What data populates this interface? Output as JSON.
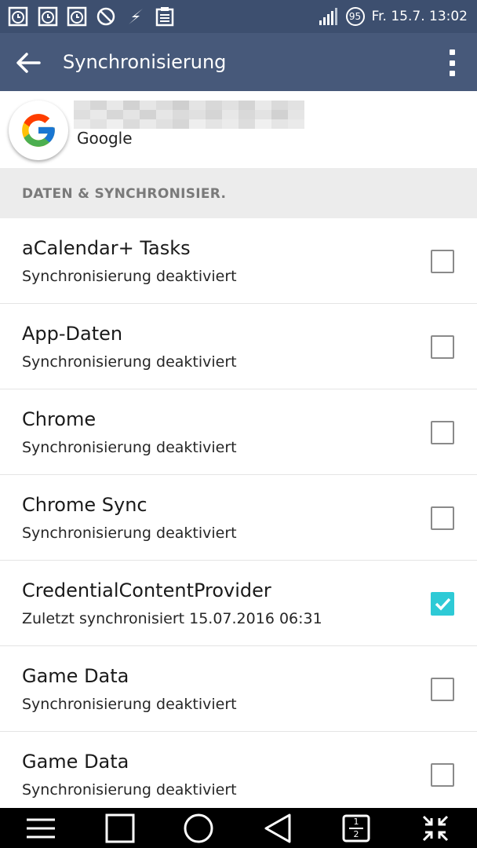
{
  "status_bar": {
    "battery_level": "95",
    "date_time": "Fr. 15.7. 13:02",
    "icons": [
      "alarm-clock-icon",
      "alarm-clock-icon",
      "alarm-clock-icon",
      "do-not-disturb-icon",
      "lightning-icon",
      "clipboard-icon",
      "signal-icon",
      "battery-icon"
    ]
  },
  "app_bar": {
    "title": "Synchronisierung",
    "back_icon": "arrow-left-icon",
    "menu_icon": "overflow-menu-icon"
  },
  "account": {
    "type": "Google",
    "logo": "google-g-icon"
  },
  "section": {
    "title": "DATEN & SYNCHRONISIER."
  },
  "sync_items": [
    {
      "title": "aCalendar+ Tasks",
      "subtitle": "Synchronisierung deaktiviert",
      "checked": false
    },
    {
      "title": "App-Daten",
      "subtitle": "Synchronisierung deaktiviert",
      "checked": false
    },
    {
      "title": "Chrome",
      "subtitle": "Synchronisierung deaktiviert",
      "checked": false
    },
    {
      "title": "Chrome Sync",
      "subtitle": "Synchronisierung deaktiviert",
      "checked": false
    },
    {
      "title": "CredentialContentProvider",
      "subtitle": "Zuletzt synchronisiert 15.07.2016 06:31",
      "checked": true
    },
    {
      "title": "Game Data",
      "subtitle": "Synchronisierung deaktiviert",
      "checked": false
    },
    {
      "title": "Game Data",
      "subtitle": "Synchronisierung deaktiviert",
      "checked": false
    }
  ],
  "nav_bar": {
    "buttons": [
      "menu-icon",
      "recents-icon",
      "home-icon",
      "back-icon",
      "dual-window-icon",
      "minimize-icon"
    ],
    "dual_window_top": "1",
    "dual_window_bottom": "2"
  },
  "colors": {
    "status_bar": "#3d4f6f",
    "app_bar": "#47597a",
    "checkbox_accent": "#2ecad6",
    "section_bg": "#ececec"
  }
}
